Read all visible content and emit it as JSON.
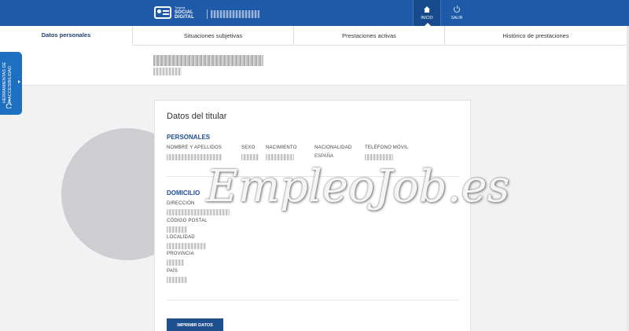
{
  "header": {
    "brand_small": "Tarjeta",
    "brand_line1": "SOCIAL",
    "brand_line2": "DIGITAL",
    "nav_home_label": "INICIO",
    "nav_logout_label": "SALIR",
    "home_icon": "home-icon",
    "logout_icon": "power-icon"
  },
  "tabs": [
    {
      "label": "Datos personales",
      "active": true
    },
    {
      "label": "Situaciones subjetivas",
      "active": false
    },
    {
      "label": "Prestaciones activas",
      "active": false
    },
    {
      "label": "Histórico de prestaciones",
      "active": false
    }
  ],
  "accessibility": {
    "label": "HERRAMIENTAS DE ACCESIBILIDAD",
    "icon": "accessibility-icon"
  },
  "card": {
    "title": "Datos del titular",
    "personales": {
      "heading": "PERSONALES",
      "labels": {
        "nombre": "NOMBRE Y APELLIDOS",
        "sexo": "SEXO",
        "nacimiento": "NACIMIENTO",
        "nacionalidad": "NACIONALIDAD",
        "telefono": "TELÉFONO MÓVIL"
      },
      "nacionalidad_value": "ESPAÑA"
    },
    "domicilio": {
      "heading": "DOMICILIO",
      "labels": {
        "direccion": "DIRECCIÓN",
        "codigo_postal": "CÓDIGO POSTAL",
        "localidad": "LOCALIDAD",
        "provincia": "PROVINCIA",
        "pais": "PAÍS"
      }
    },
    "print_button": "IMPRIMIR DATOS"
  },
  "watermark": {
    "text": "EmpleoJob.es"
  },
  "colors": {
    "header": "#1f5aa8",
    "accent": "#1f4f8f",
    "accessibility": "#1f6fc0"
  }
}
